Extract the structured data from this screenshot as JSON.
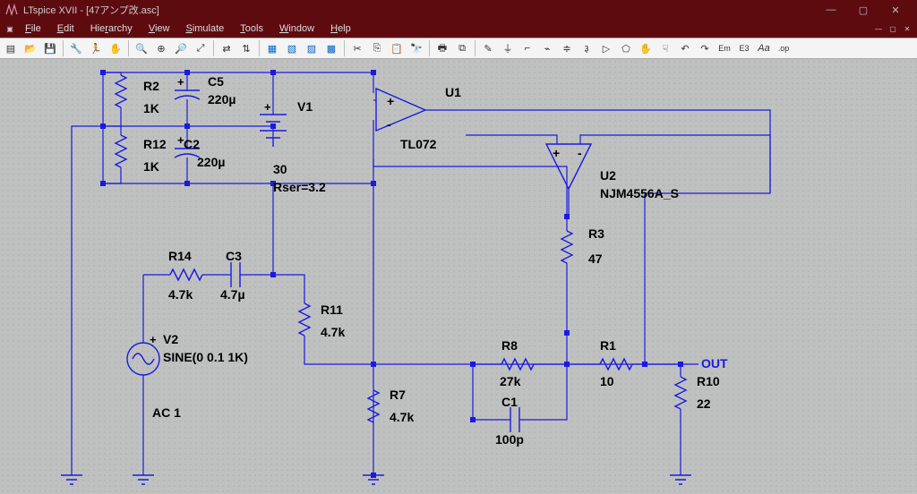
{
  "window": {
    "title": "LTspice XVII - [47アンプ改.asc]",
    "min": "—",
    "max": "▢",
    "close": "✕"
  },
  "menu": {
    "file": "File",
    "edit": "Edit",
    "hierarchy": "Hierarchy",
    "view": "View",
    "simulate": "Simulate",
    "tools": "Tools",
    "window": "Window",
    "help": "Help"
  },
  "labels": {
    "R2": "R2",
    "R2v": "1K",
    "R12": "R12",
    "R12v": "1K",
    "C5": "C5",
    "C5v": "220µ",
    "C2": "C2",
    "C2v": "220µ",
    "V1": "V1",
    "V1v1": "30",
    "V1v2": "Rser=3.2",
    "U1": "U1",
    "U1m": "TL072",
    "U2": "U2",
    "U2m": "NJM4556A_S",
    "R3": "R3",
    "R3v": "47",
    "R14": "R14",
    "R14v": "4.7k",
    "C3": "C3",
    "C3v": "4.7µ",
    "R11": "R11",
    "R11v": "4.7k",
    "V2": "V2",
    "V2v": "SINE(0 0.1 1K)",
    "AC1": "AC 1",
    "R7": "R7",
    "R7v": "4.7k",
    "R8": "R8",
    "R8v": "27k",
    "C1": "C1",
    "C1v": "100p",
    "R1": "R1",
    "R1v": "10",
    "R10": "R10",
    "R10v": "22",
    "OUT": "OUT"
  }
}
